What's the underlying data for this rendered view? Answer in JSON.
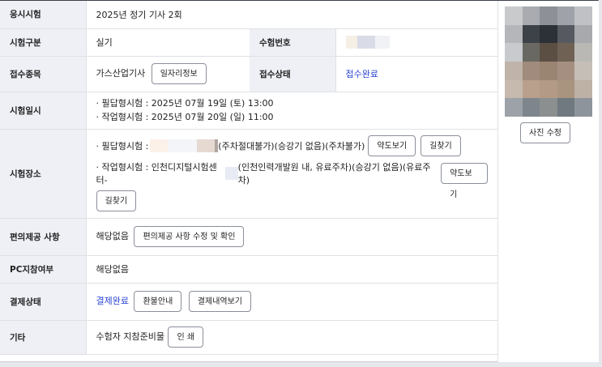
{
  "rows": {
    "exam_session": {
      "label": "응시시험",
      "value": "2025년 정기 기사 2회"
    },
    "exam_type": {
      "label": "시험구분",
      "value": "실기"
    },
    "exam_number": {
      "label": "수험번호"
    },
    "reg_category": {
      "label": "접수종목",
      "value": "가스산업기사",
      "button": "일자리정보"
    },
    "reg_status": {
      "label": "접수상태",
      "value": "접수완료"
    },
    "exam_datetime": {
      "label": "시험일시",
      "line1": "· 필답형시험 : 2025년 07월 19일 (토) 13:00",
      "line2": "· 작업형시험 : 2025년 07월 20일 (일) 11:00"
    },
    "exam_venue": {
      "label": "시험장소",
      "written_prefix": "· 필답형시험 :",
      "written_suffix": "(주차절대불가)(승강기 없음)(주차불가)",
      "practical_prefix": "· 작업형시험 : 인천디지털시험센터-",
      "practical_suffix": "(인천인력개발원 내, 유료주차)(승강기 없음)(유료주차)",
      "map_button": "약도보기",
      "route_button": "길찾기"
    },
    "accommodation": {
      "label": "편의제공 사항",
      "value": "해당없음",
      "button": "편의제공 사항 수정 및 확인"
    },
    "pc_participation": {
      "label": "PC지참여부",
      "value": "해당없음"
    },
    "payment_status": {
      "label": "결제상태",
      "value": "결제완료",
      "refund_button": "환불안내",
      "history_button": "결제내역보기"
    },
    "other": {
      "label": "기타",
      "value": "수험자 지참준비물",
      "print_button": "인 쇄"
    }
  },
  "photo": {
    "edit_button": "사진 수정"
  },
  "colors": {
    "header_bg": "#eef0f5",
    "accent_blue": "#2b45d3"
  },
  "photo_pixels": [
    "#c9cacc",
    "#a9abb0",
    "#8d9096",
    "#9fa2a8",
    "#bfc1c5",
    "#b4b6ba",
    "#3d4148",
    "#2c3037",
    "#565a60",
    "#a7a9ad",
    "#c8cacd",
    "#6a6862",
    "#5b4f44",
    "#6f6255",
    "#b9b8b5",
    "#c0b4aa",
    "#a08b7c",
    "#9a8472",
    "#a58f80",
    "#c5beb7",
    "#c6b9ad",
    "#b9a08d",
    "#b39a86",
    "#a9947f",
    "#bdb1a6",
    "#9ca2a8",
    "#7e858c",
    "#8b8f90",
    "#707880",
    "#8d949b"
  ]
}
